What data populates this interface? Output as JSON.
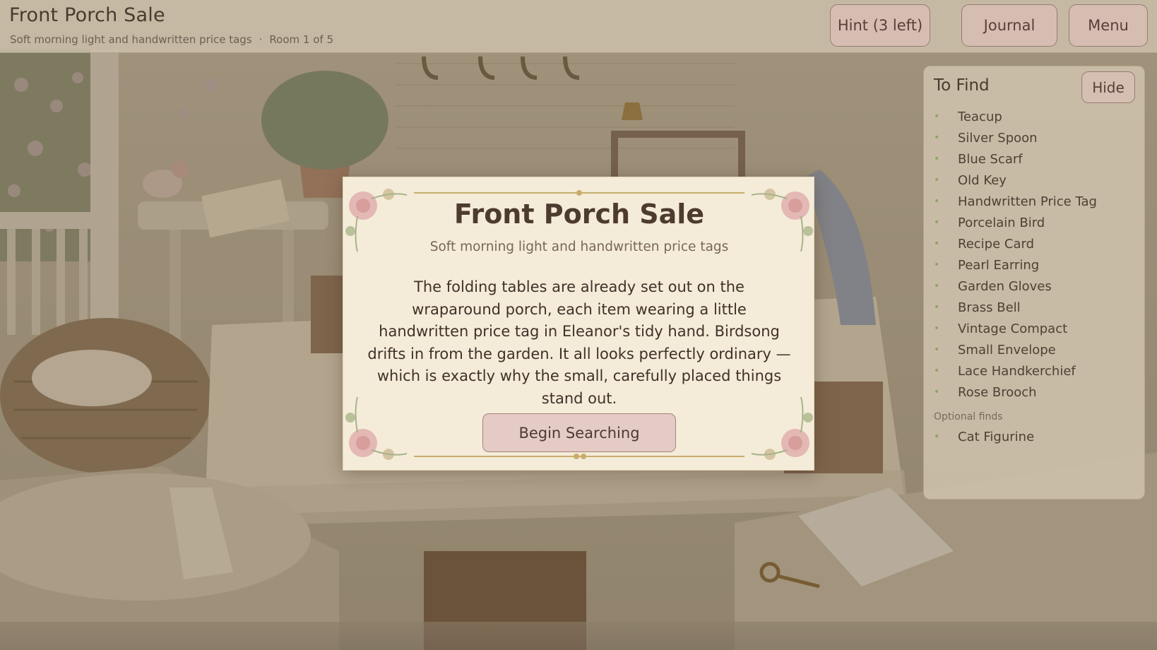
{
  "header": {
    "title": "Front Porch Sale",
    "subtitle": "Soft morning light and handwritten price tags",
    "separator": "·",
    "room_progress": "Room 1 of 5",
    "hint_button": "Hint (3 left)",
    "journal_button": "Journal",
    "menu_button": "Menu"
  },
  "panel": {
    "title": "To Find",
    "hide_button": "Hide",
    "items": [
      "Teacup",
      "Silver Spoon",
      "Blue Scarf",
      "Old Key",
      "Handwritten Price Tag",
      "Porcelain Bird",
      "Recipe Card",
      "Pearl Earring",
      "Garden Gloves",
      "Brass Bell",
      "Vintage Compact",
      "Small Envelope",
      "Lace Handkerchief",
      "Rose Brooch"
    ],
    "optional_label": "Optional finds",
    "optional_items": [
      "Cat Figurine"
    ],
    "bullet": "•"
  },
  "modal": {
    "title": "Front Porch Sale",
    "subtitle": "Soft morning light and handwritten price tags",
    "body": "The folding tables are already set out on the wraparound porch, each item wearing a little handwritten price tag in Eleanor's tidy hand. Birdsong drifts in from the garden. It all looks perfectly ordinary — which is exactly why the small, carefully placed things stand out.",
    "button": "Begin Searching"
  },
  "colors": {
    "accent_button": "#e5cbc5",
    "button_border": "#9b7b72",
    "card": "#f4ecd9",
    "text_dark": "#4e3b2f",
    "bullet_green": "#8ea268"
  }
}
